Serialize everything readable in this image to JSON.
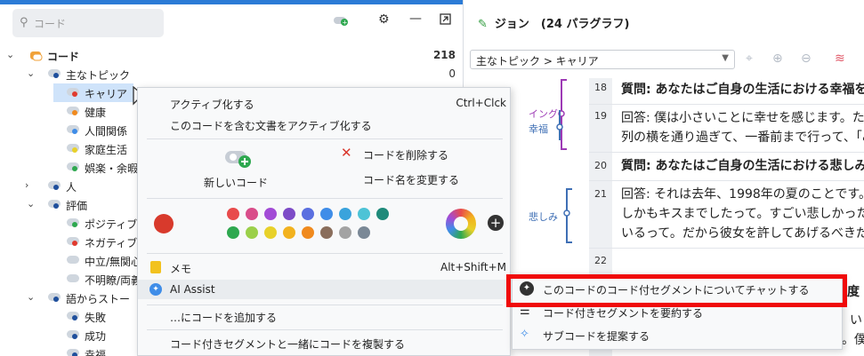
{
  "search": {
    "placeholder": "コード"
  },
  "tree": {
    "root": {
      "label": "コード",
      "count": "218"
    },
    "items": [
      {
        "label": "主なトピック",
        "count": "0"
      },
      {
        "label": "キャリア"
      },
      {
        "label": "健康"
      },
      {
        "label": "人間関係"
      },
      {
        "label": "家庭生活"
      },
      {
        "label": "娯楽・余暇"
      },
      {
        "label": "人"
      },
      {
        "label": "評価"
      },
      {
        "label": "ポジティブ"
      },
      {
        "label": "ネガティブ"
      },
      {
        "label": "中立/無関心"
      },
      {
        "label": "不明瞭/両義"
      },
      {
        "label": "語からストー"
      },
      {
        "label": "失敗"
      },
      {
        "label": "成功"
      },
      {
        "label": "幸福"
      }
    ]
  },
  "right": {
    "title": "ジョン　(24 パラグラフ)",
    "dropdown": "主なトピック > キャリア",
    "margin_labels": {
      "a": "イング",
      "b": "幸福",
      "c": "悲しみ"
    },
    "paragraphs": [
      {
        "num": "18",
        "lines": [
          "質問: あなたはご自身の生活における幸福を"
        ]
      },
      {
        "num": "19",
        "lines": [
          "回答: 僕は小さいことに幸せを感じます。たと",
          "列の横を通り過ぎて、一番前まで行って、「み"
        ]
      },
      {
        "num": "20",
        "lines": [
          "質問: あなたはご自身の生活における悲しみ"
        ]
      },
      {
        "num": "21",
        "lines": [
          "回答: それは去年、1998年の夏のことです。",
          "しかもキスまでしたって。すごい悲しかったし、怒",
          "いるって。だから彼女を許してあげるべきだって"
        ]
      },
      {
        "num": "22",
        "lines": [
          ""
        ]
      }
    ],
    "partial": {
      "a": "度",
      "b": "い",
      "c": "。僕"
    }
  },
  "menu": {
    "activate": "アクティブ化する",
    "activate_key": "Ctrl+Clck",
    "activate_docs": "このコードを含む文書をアクティブ化する",
    "new_code": "新しいコード",
    "delete_code": "コードを削除する",
    "rename_code": "コード名を変更する",
    "memo": "メモ",
    "memo_key": "Alt+Shift+M",
    "ai_assist": "AI Assist",
    "add_code_to": "…にコードを追加する",
    "duplicate": "コード付きセグメントと一緒にコードを複製する",
    "colors": [
      "#e84b4b",
      "#d94d8a",
      "#a24bd6",
      "#7d4bc7",
      "#5a6fe0",
      "#3f8de8",
      "#3aa3dc",
      "#4dc3d6",
      "#1f8a7a",
      "#2ea84f",
      "#9bd04a",
      "#e8d12a",
      "#f2b21f",
      "#f08a1e",
      "#8a6e5c",
      "#a3a3a3",
      "#7a8896"
    ],
    "current_color": "#d83a2c"
  },
  "submenu": {
    "chat": "このコードのコード付セグメントについてチャットする",
    "summarize": "コード付きセグメントを要約する",
    "suggest": "サブコードを提案する"
  }
}
